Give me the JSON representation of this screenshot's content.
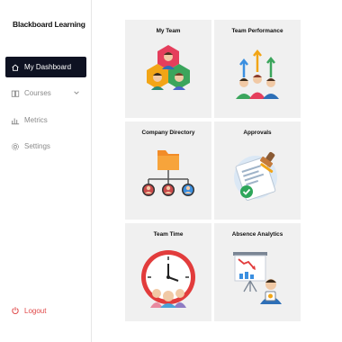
{
  "sidebar": {
    "brand": "Blackboard Learning",
    "items": [
      {
        "label": "My Dashboard",
        "icon": "home-icon",
        "active": true
      },
      {
        "label": "Courses",
        "icon": "book-icon",
        "expandable": true
      },
      {
        "label": "Metrics",
        "icon": "bar-chart-icon"
      },
      {
        "label": "Settings",
        "icon": "gear-icon"
      }
    ],
    "logout": {
      "label": "Logout",
      "icon": "power-icon",
      "color": "#e04848"
    }
  },
  "cards": [
    {
      "title": "My Team",
      "icon": "team-hexagon-icon"
    },
    {
      "title": "Team Performance",
      "icon": "team-growth-icon"
    },
    {
      "title": "Company Directory",
      "icon": "folder-hierarchy-icon"
    },
    {
      "title": "Approvals",
      "icon": "approved-document-stamp-icon"
    },
    {
      "title": "Team Time",
      "icon": "clock-team-icon"
    },
    {
      "title": "Absence Analytics",
      "icon": "presentation-analytics-icon"
    }
  ],
  "colors": {
    "active_nav_bg": "#0e1222",
    "card_bg": "#f0f0f0",
    "accent_orange": "#f28c28"
  }
}
